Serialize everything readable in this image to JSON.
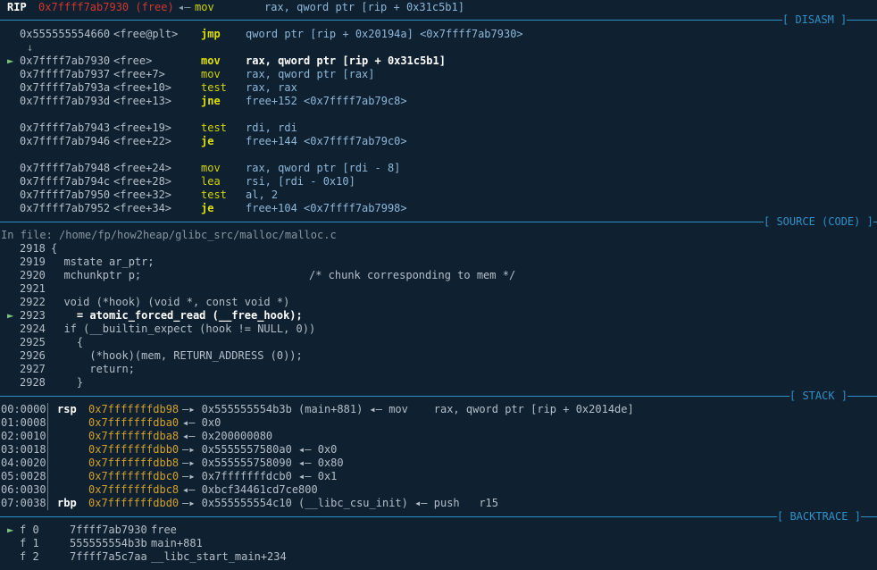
{
  "top": {
    "reg": "RIP",
    "addr": "0x7ffff7ab7930 (free)",
    "arrow": "◂—",
    "instr": "mov",
    "ops": "rax, qword ptr [rip + 0x31c5b1]"
  },
  "disasm": {
    "title": "[ DISASM ]",
    "lines": [
      {
        "mark": "",
        "addr": "0x555555554660",
        "sym": "<free@plt>",
        "op": "jmp",
        "args": "qword ptr [rip + 0x20194a] <0x7ffff7ab7930>",
        "hl": true
      },
      {
        "mark": "↓",
        "addr": "",
        "sym": "",
        "op": "",
        "args": ""
      },
      {
        "mark": "►",
        "addr": "0x7ffff7ab7930",
        "sym": "<free>",
        "op": "mov",
        "args": "rax, qword ptr [rip + 0x31c5b1]",
        "cur": true
      },
      {
        "mark": "",
        "addr": "0x7ffff7ab7937",
        "sym": "<free+7>",
        "op": "mov",
        "args": "rax, qword ptr [rax]"
      },
      {
        "mark": "",
        "addr": "0x7ffff7ab793a",
        "sym": "<free+10>",
        "op": "test",
        "args": "rax, rax"
      },
      {
        "mark": "",
        "addr": "0x7ffff7ab793d",
        "sym": "<free+13>",
        "op": "jne",
        "args": "free+152 <0x7ffff7ab79c8>",
        "hl": true
      },
      {
        "mark": "",
        "addr": "",
        "sym": "",
        "op": "",
        "args": ""
      },
      {
        "mark": "",
        "addr": "0x7ffff7ab7943",
        "sym": "<free+19>",
        "op": "test",
        "args": "rdi, rdi"
      },
      {
        "mark": "",
        "addr": "0x7ffff7ab7946",
        "sym": "<free+22>",
        "op": "je",
        "args": "free+144 <0x7ffff7ab79c0>",
        "hl": true
      },
      {
        "mark": "",
        "addr": "",
        "sym": "",
        "op": "",
        "args": ""
      },
      {
        "mark": "",
        "addr": "0x7ffff7ab7948",
        "sym": "<free+24>",
        "op": "mov",
        "args": "rax, qword ptr [rdi - 8]"
      },
      {
        "mark": "",
        "addr": "0x7ffff7ab794c",
        "sym": "<free+28>",
        "op": "lea",
        "args": "rsi, [rdi - 0x10]"
      },
      {
        "mark": "",
        "addr": "0x7ffff7ab7950",
        "sym": "<free+32>",
        "op": "test",
        "args": "al, 2"
      },
      {
        "mark": "",
        "addr": "0x7ffff7ab7952",
        "sym": "<free+34>",
        "op": "je",
        "args": "free+104 <0x7ffff7ab7998>",
        "hl": true
      }
    ]
  },
  "source": {
    "title": "[ SOURCE (CODE) ]",
    "file_label": "In file: /home/fp/how2heap/glibc_src/malloc/malloc.c",
    "lines": [
      {
        "mark": "",
        "no": "2918",
        "code": "{"
      },
      {
        "mark": "",
        "no": "2919",
        "code": "  mstate ar_ptr;"
      },
      {
        "mark": "",
        "no": "2920",
        "code": "  mchunkptr p;                          /* chunk corresponding to mem */"
      },
      {
        "mark": "",
        "no": "2921",
        "code": ""
      },
      {
        "mark": "",
        "no": "2922",
        "code": "  void (*hook) (void *, const void *)"
      },
      {
        "mark": "►",
        "no": "2923",
        "code": "    = atomic_forced_read (__free_hook);"
      },
      {
        "mark": "",
        "no": "2924",
        "code": "  if (__builtin_expect (hook != NULL, 0))"
      },
      {
        "mark": "",
        "no": "2925",
        "code": "    {"
      },
      {
        "mark": "",
        "no": "2926",
        "code": "      (*hook)(mem, RETURN_ADDRESS (0));"
      },
      {
        "mark": "",
        "no": "2927",
        "code": "      return;"
      },
      {
        "mark": "",
        "no": "2928",
        "code": "    }"
      }
    ]
  },
  "stack": {
    "title": "[ STACK ]",
    "lines": [
      {
        "idx": "00:0000",
        "reg": "rsp",
        "addr": "0x7fffffffdb98",
        "chain": "—▸ 0x555555554b3b (main+881) ◂— mov    rax, qword ptr [rip + 0x2014de]"
      },
      {
        "idx": "01:0008",
        "reg": "",
        "addr": "0x7fffffffdba0",
        "chain": "◂— 0x0"
      },
      {
        "idx": "02:0010",
        "reg": "",
        "addr": "0x7fffffffdba8",
        "chain": "◂— 0x200000080"
      },
      {
        "idx": "03:0018",
        "reg": "",
        "addr": "0x7fffffffdbb0",
        "chain": "—▸ 0x5555557580a0 ◂— 0x0"
      },
      {
        "idx": "04:0020",
        "reg": "",
        "addr": "0x7fffffffdbb8",
        "chain": "—▸ 0x555555758090 ◂— 0x80"
      },
      {
        "idx": "05:0028",
        "reg": "",
        "addr": "0x7fffffffdbc0",
        "chain": "—▸ 0x7fffffffdcb0 ◂— 0x1"
      },
      {
        "idx": "06:0030",
        "reg": "",
        "addr": "0x7fffffffdbc8",
        "chain": "◂— 0xbcf34461cd7ce800"
      },
      {
        "idx": "07:0038",
        "reg": "rbp",
        "addr": "0x7fffffffdbd0",
        "chain": "—▸ 0x555555554c10 (__libc_csu_init) ◂— push   r15"
      }
    ]
  },
  "backtrace": {
    "title": "[ BACKTRACE ]",
    "lines": [
      {
        "mark": "►",
        "frame": "f 0",
        "addr": "7ffff7ab7930",
        "sym": "free"
      },
      {
        "mark": "",
        "frame": "f 1",
        "addr": "555555554b3b",
        "sym": "main+881"
      },
      {
        "mark": "",
        "frame": "f 2",
        "addr": "7ffff7a5c7aa",
        "sym": "__libc_start_main+234"
      }
    ]
  }
}
